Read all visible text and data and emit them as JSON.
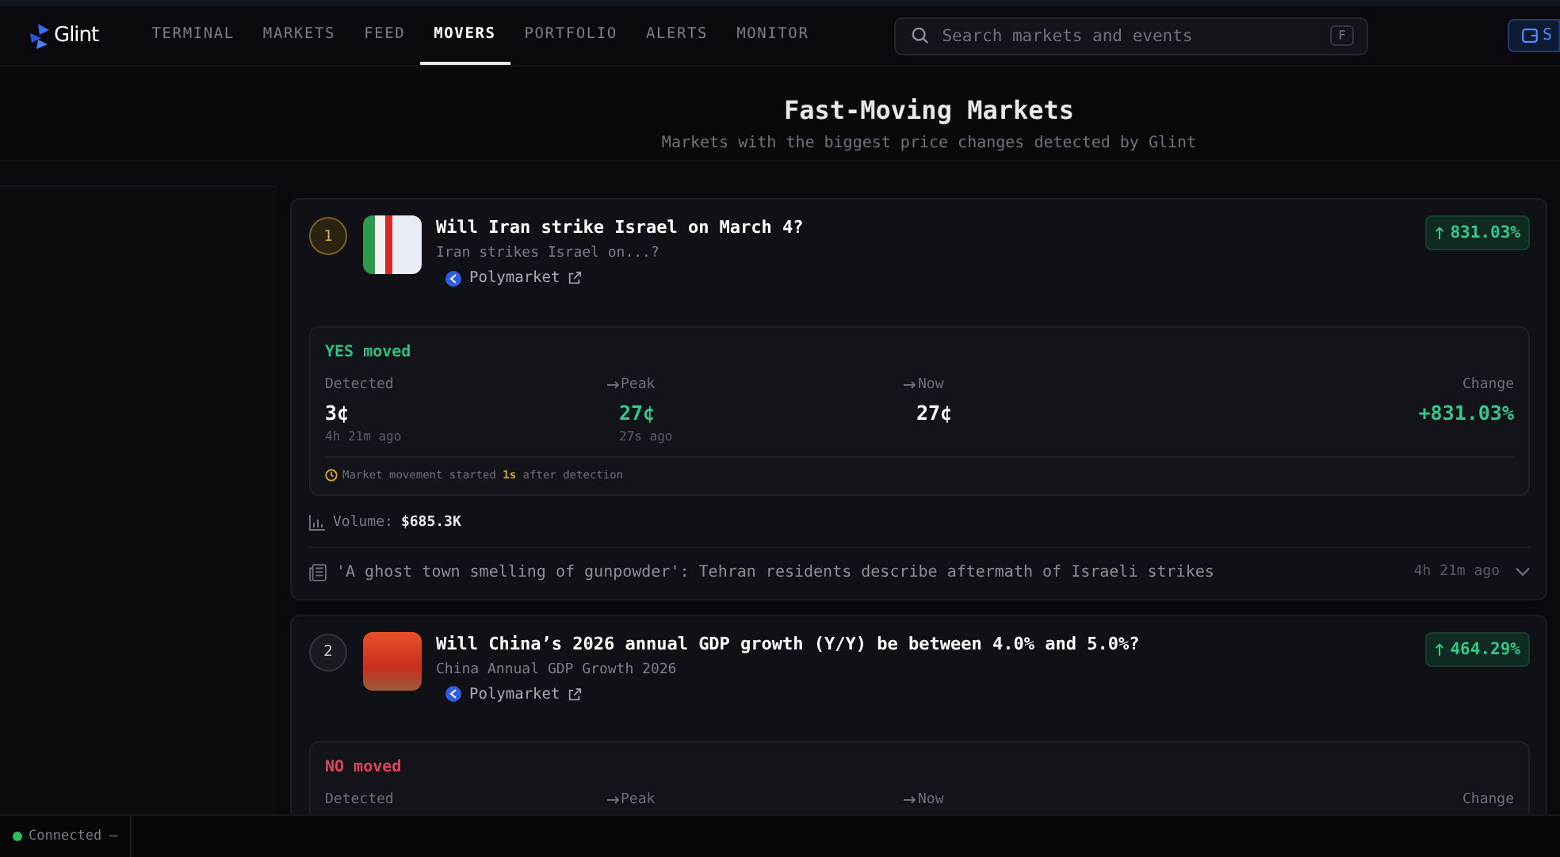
{
  "header": {
    "logo": "Glint",
    "nav": [
      {
        "label": "TERMINAL",
        "selected": false
      },
      {
        "label": "MARKETS",
        "selected": false
      },
      {
        "label": "FEED",
        "selected": false
      },
      {
        "label": "MOVERS",
        "selected": true
      },
      {
        "label": "PORTFOLIO",
        "selected": false
      },
      {
        "label": "ALERTS",
        "selected": false
      },
      {
        "label": "MONITOR",
        "selected": false
      }
    ],
    "search": {
      "placeholder": "Search markets and events",
      "shortcut": "F"
    },
    "action_button": "S"
  },
  "page": {
    "title": "Fast-Moving Markets",
    "subtitle": "Markets with the biggest price changes detected by Glint"
  },
  "markets": [
    {
      "rank": "1",
      "top_rank": true,
      "title": "Will Iran strike Israel on March 4?",
      "subtitle": "Iran strikes Israel on...?",
      "source": "Polymarket",
      "change": "831.03%",
      "move": {
        "positive": true,
        "label": "YES moved",
        "columns": [
          {
            "label": "Detected",
            "value": "3¢",
            "ago": "4h 21m ago",
            "highlight": false
          },
          {
            "label": "Peak",
            "value": "27¢",
            "ago": "27s ago",
            "highlight": true
          },
          {
            "label": "Now",
            "value": "27¢",
            "highlight": false
          },
          {
            "label": "Change",
            "value": "+831.03%",
            "highlight": true
          }
        ],
        "note": "Market movement started **1s** after detection"
      },
      "volume_label": "Volume:",
      "volume": "$685.3K",
      "news": {
        "text": "'A ghost town smelling of gunpowder': Tehran residents describe aftermath of Israeli strikes",
        "time": "4h 21m ago",
        "expanded": false
      }
    },
    {
      "rank": "2",
      "top_rank": false,
      "title": "Will China’s 2026 annual GDP growth (Y/Y) be between 4.0% and 5.0%?",
      "subtitle": "China Annual GDP Growth 2026",
      "source": "Polymarket",
      "change": "464.29%",
      "move": {
        "positive": false,
        "label": "NO moved",
        "columns": [
          {
            "label": "Detected"
          },
          {
            "label": "Peak"
          },
          {
            "label": "Now"
          },
          {
            "label": "Change"
          }
        ]
      }
    }
  ],
  "status": {
    "online": true,
    "text": "Connected –"
  }
}
